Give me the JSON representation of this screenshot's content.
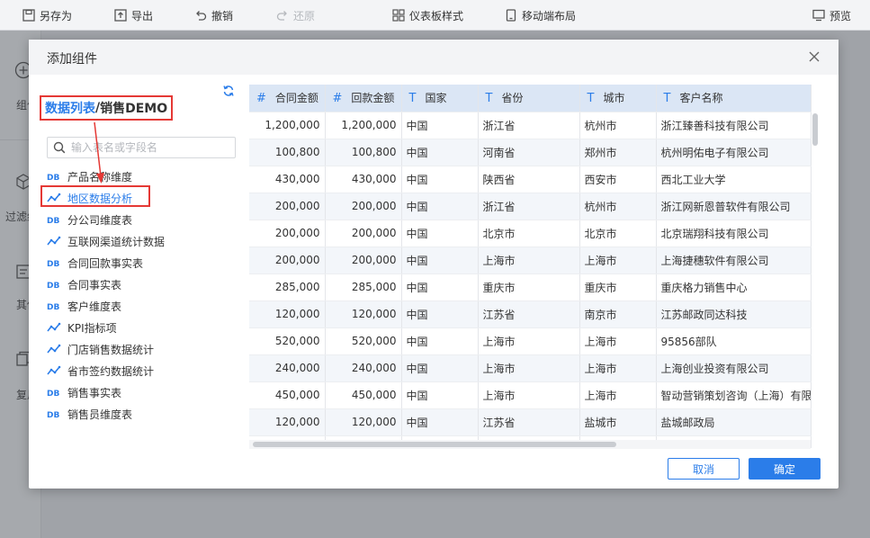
{
  "toolbar": {
    "save_as": "另存为",
    "export": "导出",
    "undo": "撤销",
    "redo": "还原",
    "dashboard_style": "仪表板样式",
    "mobile_layout": "移动端布局",
    "preview": "预览"
  },
  "side": {
    "item1": "组件",
    "item2": "过滤组件",
    "item3": "其他",
    "item4": "复用"
  },
  "modal": {
    "title": "添加组件",
    "breadcrumb_link": "数据列表",
    "breadcrumb_sep": "/",
    "breadcrumb_current": "销售DEMO",
    "search_placeholder": "输入表名或字段名",
    "cancel_label": "取消",
    "ok_label": "确定"
  },
  "tables": [
    {
      "name": "产品名称维度",
      "icon": "db-table-icon"
    },
    {
      "name": "地区数据分析",
      "icon": "analysis-icon"
    },
    {
      "name": "分公司维度表",
      "icon": "db-table-icon"
    },
    {
      "name": "互联网渠道统计数据",
      "icon": "analysis-icon"
    },
    {
      "name": "合同回款事实表",
      "icon": "db-table-icon"
    },
    {
      "name": "合同事实表",
      "icon": "db-table-icon"
    },
    {
      "name": "客户维度表",
      "icon": "db-table-icon"
    },
    {
      "name": "KPI指标项",
      "icon": "analysis-icon"
    },
    {
      "name": "门店销售数据统计",
      "icon": "analysis-icon"
    },
    {
      "name": "省市签约数据统计",
      "icon": "analysis-icon"
    },
    {
      "name": "销售事实表",
      "icon": "db-table-icon"
    },
    {
      "name": "销售员维度表",
      "icon": "db-table-icon"
    }
  ],
  "grid": {
    "columns": [
      {
        "type": "#",
        "label": "合同金额"
      },
      {
        "type": "#",
        "label": "回款金额"
      },
      {
        "type": "T",
        "label": "国家"
      },
      {
        "type": "T",
        "label": "省份"
      },
      {
        "type": "T",
        "label": "城市"
      },
      {
        "type": "T",
        "label": "客户名称"
      }
    ],
    "rows": [
      [
        "1,200,000",
        "1,200,000",
        "中国",
        "浙江省",
        "杭州市",
        "浙江臻善科技有限公司"
      ],
      [
        "100,800",
        "100,800",
        "中国",
        "河南省",
        "郑州市",
        "杭州明佑电子有限公司"
      ],
      [
        "430,000",
        "430,000",
        "中国",
        "陕西省",
        "西安市",
        "西北工业大学"
      ],
      [
        "200,000",
        "200,000",
        "中国",
        "浙江省",
        "杭州市",
        "浙江网新恩普软件有限公司"
      ],
      [
        "200,000",
        "200,000",
        "中国",
        "北京市",
        "北京市",
        "北京瑞翔科技有限公司"
      ],
      [
        "200,000",
        "200,000",
        "中国",
        "上海市",
        "上海市",
        "上海捷穗软件有限公司"
      ],
      [
        "285,000",
        "285,000",
        "中国",
        "重庆市",
        "重庆市",
        "重庆格力销售中心"
      ],
      [
        "120,000",
        "120,000",
        "中国",
        "江苏省",
        "南京市",
        "江苏邮政同达科技"
      ],
      [
        "520,000",
        "520,000",
        "中国",
        "上海市",
        "上海市",
        "95856部队"
      ],
      [
        "240,000",
        "240,000",
        "中国",
        "上海市",
        "上海市",
        "上海创业投资有限公司"
      ],
      [
        "450,000",
        "450,000",
        "中国",
        "上海市",
        "上海市",
        "智动营销策划咨询（上海）有限"
      ],
      [
        "120,000",
        "120,000",
        "中国",
        "江苏省",
        "盐城市",
        "盐城邮政局"
      ],
      [
        "",
        "",
        "",
        "",
        "",
        ""
      ]
    ]
  },
  "colors": {
    "accent": "#2b7de9",
    "highlight": "#e53935",
    "header_bg": "#dbe6f5"
  }
}
